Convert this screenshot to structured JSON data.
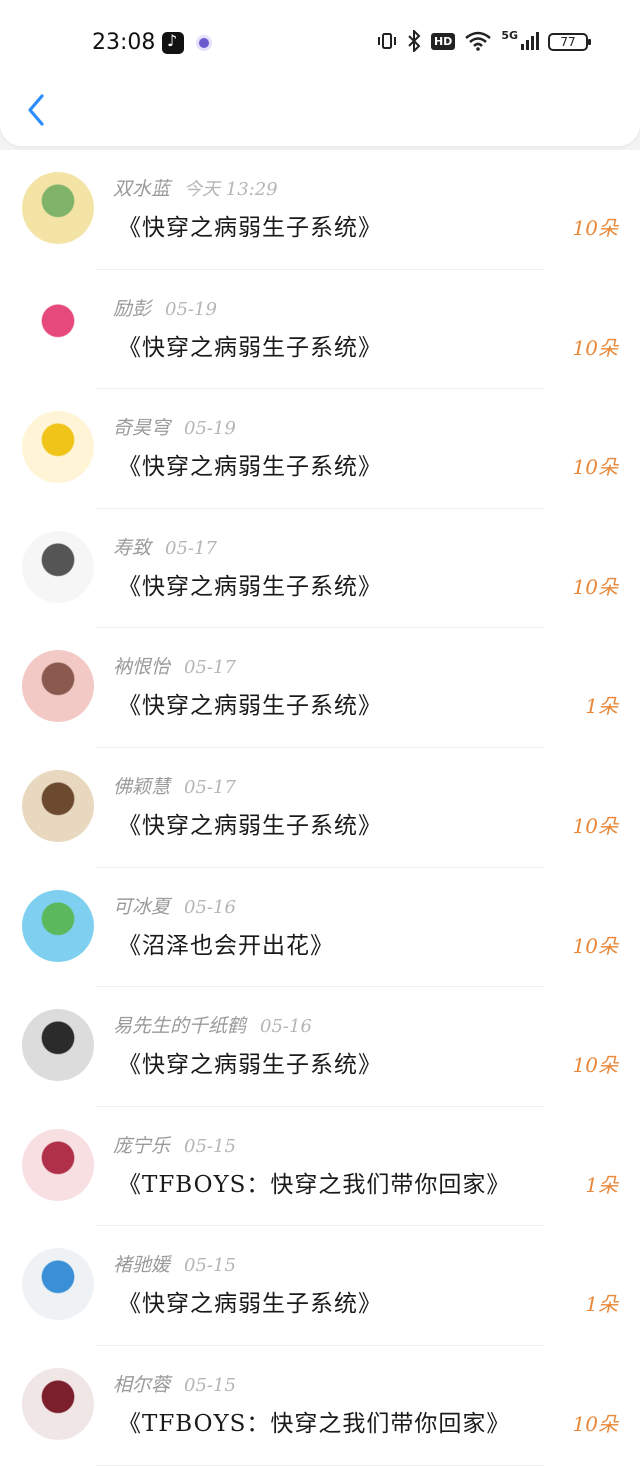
{
  "status": {
    "time": "23:08",
    "battery": "77",
    "network": "5G",
    "hd": "HD"
  },
  "icons": {
    "back": "chevron-left-icon",
    "tiktok": "tiktok-icon",
    "app": "circle-app-icon",
    "vibrate": "vibrate-icon",
    "bluetooth": "bluetooth-icon",
    "wifi": "wifi-icon",
    "signal": "signal-icon"
  },
  "colors": {
    "accent": "#e8883a",
    "back": "#2a8cff"
  },
  "items": [
    {
      "name": "双水蓝",
      "date": "今天 13:29",
      "title": "《快穿之病弱生子系统》",
      "count": "10朵",
      "avatar_colors": [
        "#f3e4a6",
        "#7fb36a"
      ]
    },
    {
      "name": "励彭",
      "date": "05-19",
      "title": "《快穿之病弱生子系统》",
      "count": "10朵",
      "avatar_colors": [
        "#ffffff",
        "#e64a7a"
      ]
    },
    {
      "name": "奇昊穹",
      "date": "05-19",
      "title": "《快穿之病弱生子系统》",
      "count": "10朵",
      "avatar_colors": [
        "#fff5d6",
        "#f0c419"
      ]
    },
    {
      "name": "寿致",
      "date": "05-17",
      "title": "《快穿之病弱生子系统》",
      "count": "10朵",
      "avatar_colors": [
        "#f6f6f6",
        "#555555"
      ]
    },
    {
      "name": "衲恨怡",
      "date": "05-17",
      "title": "《快穿之病弱生子系统》",
      "count": "1朵",
      "avatar_colors": [
        "#f2c9c4",
        "#8a5a4f"
      ]
    },
    {
      "name": "佛颖慧",
      "date": "05-17",
      "title": "《快穿之病弱生子系统》",
      "count": "10朵",
      "avatar_colors": [
        "#e9d8c0",
        "#6b4a30"
      ]
    },
    {
      "name": "可冰夏",
      "date": "05-16",
      "title": "《沼泽也会开出花》",
      "count": "10朵",
      "avatar_colors": [
        "#7fd0f0",
        "#5cb85c"
      ]
    },
    {
      "name": "易先生的千纸鹤",
      "date": "05-16",
      "title": "《快穿之病弱生子系统》",
      "count": "10朵",
      "avatar_colors": [
        "#dcdcdc",
        "#2b2b2b"
      ]
    },
    {
      "name": "庞宁乐",
      "date": "05-15",
      "title": "《TFBOYS：快穿之我们带你回家》",
      "count": "1朵",
      "avatar_colors": [
        "#f7dfe2",
        "#b0304a"
      ]
    },
    {
      "name": "褚驰媛",
      "date": "05-15",
      "title": "《快穿之病弱生子系统》",
      "count": "1朵",
      "avatar_colors": [
        "#eef2f5",
        "#3a8fd6"
      ]
    },
    {
      "name": "相尔蓉",
      "date": "05-15",
      "title": "《TFBOYS：快穿之我们带你回家》",
      "count": "10朵",
      "avatar_colors": [
        "#f0e6e6",
        "#7a1f2b"
      ]
    }
  ]
}
